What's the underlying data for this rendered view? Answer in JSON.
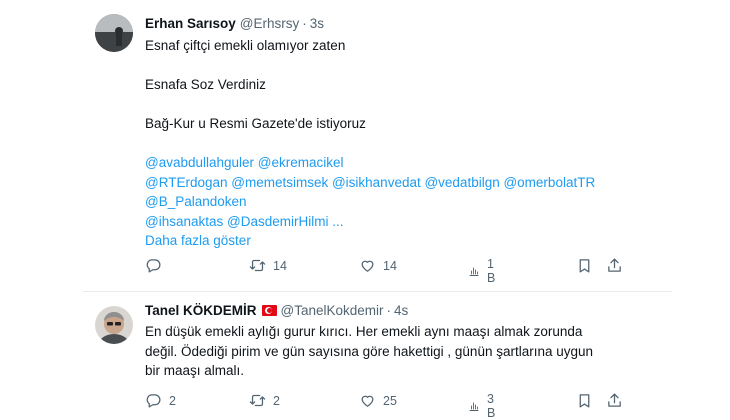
{
  "tweets": [
    {
      "name": "Erhan Sarısoy",
      "handle": "@Erhsrsy",
      "dot": "·",
      "time": "3s",
      "lines": [
        "Esnaf çiftçi emekli olamıyor zaten",
        "",
        "Esnafa Soz Verdiniz",
        "",
        "Bağ-Kur u Resmi Gazete'de istiyoruz"
      ],
      "mentions": [
        "@avabdullahguler @ekremacikel",
        "@RTErdogan @memetsimsek @isikhanvedat @vedatbilgn @omerbolatTR",
        "@B_Palandoken",
        "@ihsanaktas @DasdemirHilmi ..."
      ],
      "show_more": "Daha fazla göster",
      "replies": "",
      "retweets": "14",
      "likes": "14",
      "views": "1 B"
    },
    {
      "name": "Tanel KÖKDEMİR",
      "handle": "@TanelKokdemir",
      "dot": "·",
      "time": "4s",
      "lines": [
        "En düşük emekli aylığı gurur kırıcı. Her emekli aynı maaşı almak zorunda",
        "değil.  Ödediği pirim ve gün sayısına göre hakettigi , günün şartlarına uygun",
        "bir maaşı almalı."
      ],
      "replies": "2",
      "retweets": "2",
      "likes": "25",
      "views": "3 B"
    }
  ],
  "colors": {
    "link": "#1d9bf0",
    "muted": "#536471",
    "text": "#0f1419",
    "flag": "#e30a17"
  },
  "icons": [
    "reply-icon",
    "retweet-icon",
    "like-icon",
    "views-icon",
    "bookmark-icon",
    "share-icon"
  ]
}
